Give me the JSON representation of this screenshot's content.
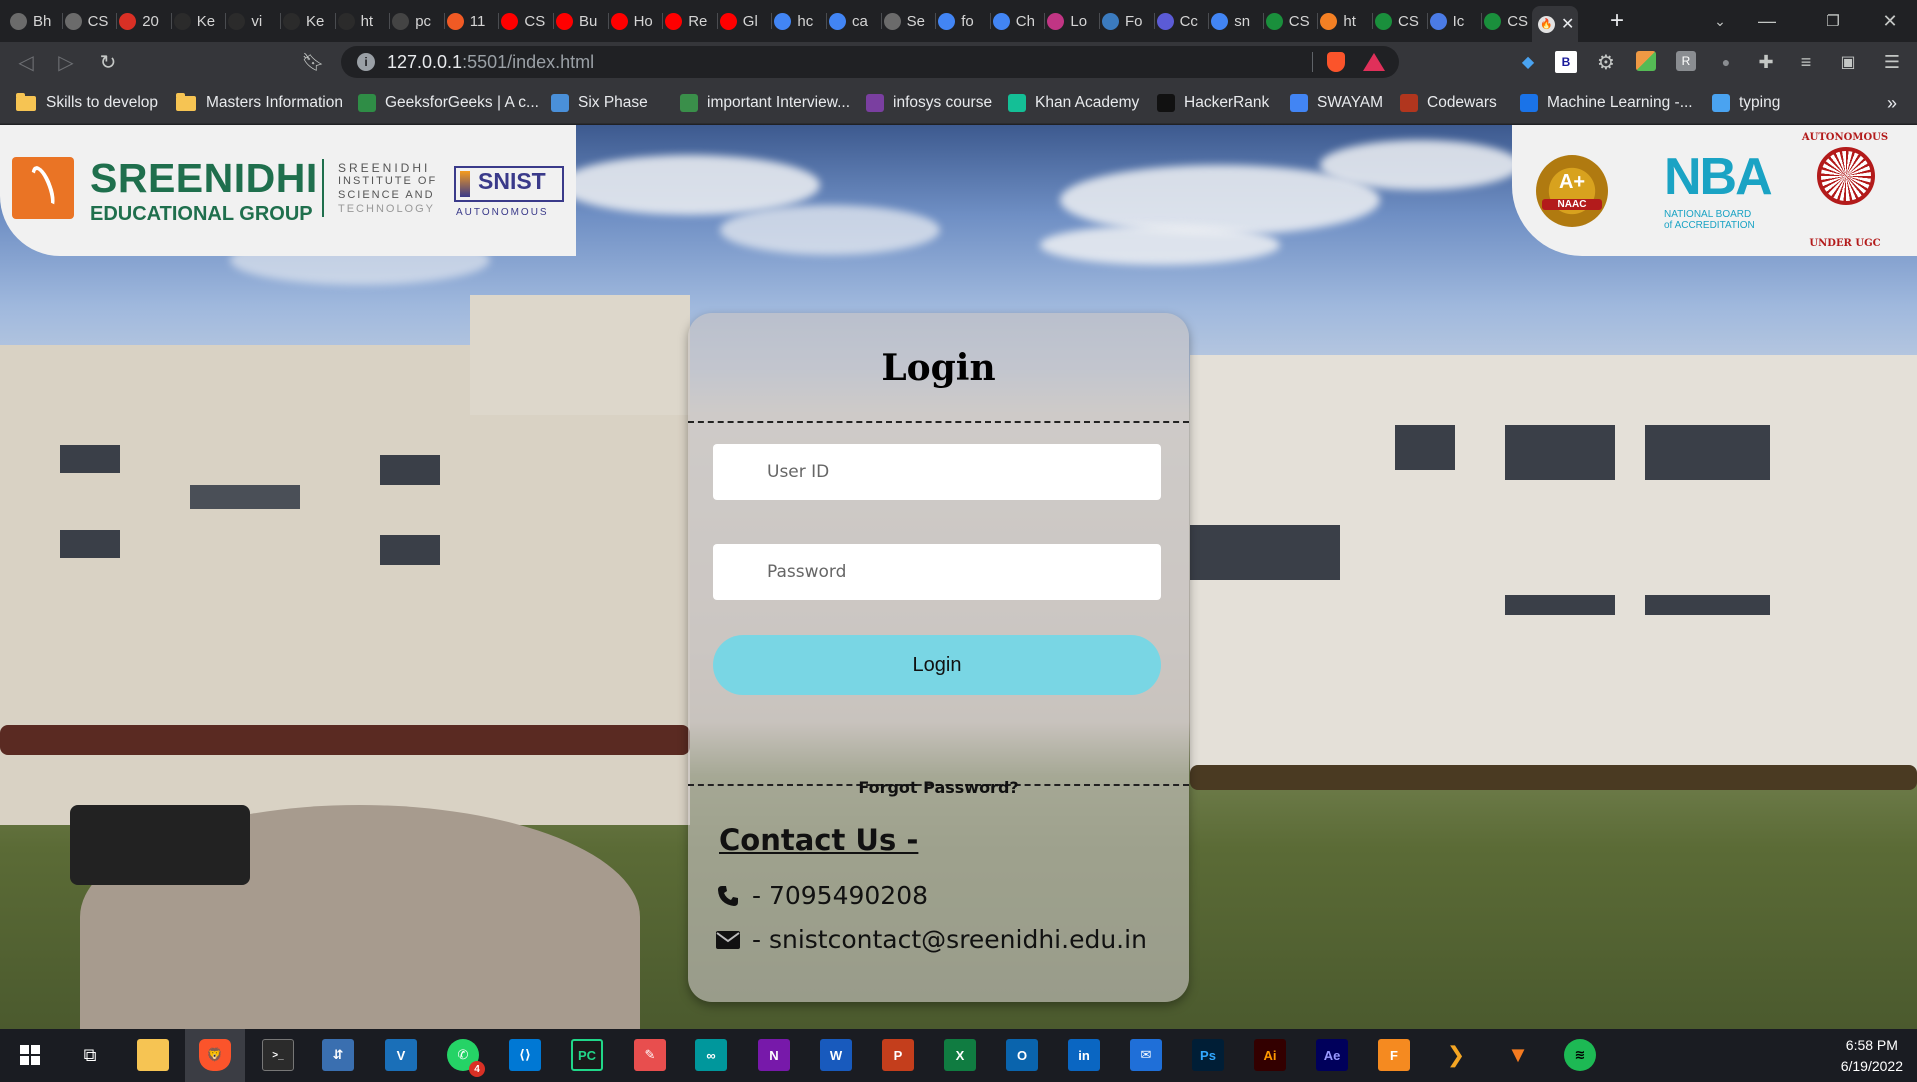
{
  "browser": {
    "tabs": [
      {
        "label": "Bh",
        "icon": "globe-icon",
        "color": "#6b6b6b"
      },
      {
        "label": "CS",
        "icon": "globe-icon",
        "color": "#6b6b6b"
      },
      {
        "label": "20",
        "icon": "gmail-icon",
        "color": "#d93025"
      },
      {
        "label": "Ke",
        "icon": "w3schools-icon",
        "color": "#2b2b2b"
      },
      {
        "label": "vi",
        "icon": "w3schools-icon",
        "color": "#2b2b2b"
      },
      {
        "label": "Ke",
        "icon": "w3schools-icon",
        "color": "#2b2b2b"
      },
      {
        "label": "ht",
        "icon": "w3schools-icon",
        "color": "#2b2b2b"
      },
      {
        "label": "pc",
        "icon": "medium-icon",
        "color": "#444444"
      },
      {
        "label": "11",
        "icon": "bookmark-orange-icon",
        "color": "#f15a24"
      },
      {
        "label": "CS",
        "icon": "youtube-icon",
        "color": "#ff0000"
      },
      {
        "label": "Bu",
        "icon": "youtube-icon",
        "color": "#ff0000"
      },
      {
        "label": "Ho",
        "icon": "youtube-icon",
        "color": "#ff0000"
      },
      {
        "label": "Re",
        "icon": "youtube-icon",
        "color": "#ff0000"
      },
      {
        "label": "Gl",
        "icon": "youtube-icon",
        "color": "#ff0000"
      },
      {
        "label": "hc",
        "icon": "google-icon",
        "color": "#4285f4"
      },
      {
        "label": "ca",
        "icon": "google-icon",
        "color": "#4285f4"
      },
      {
        "label": "Se",
        "icon": "globe-icon",
        "color": "#6b6b6b"
      },
      {
        "label": "fo",
        "icon": "google-icon",
        "color": "#4285f4"
      },
      {
        "label": "Ch",
        "icon": "google-icon",
        "color": "#4285f4"
      },
      {
        "label": "Lo",
        "icon": "instagram-icon",
        "color": "#c13584"
      },
      {
        "label": "Fo",
        "icon": "world-icon",
        "color": "#3b7bbf"
      },
      {
        "label": "Cc",
        "icon": "codepen-icon",
        "color": "#5b5bd6"
      },
      {
        "label": "sn",
        "icon": "google-icon",
        "color": "#4285f4"
      },
      {
        "label": "CS",
        "icon": "w-icon",
        "color": "#1a8f3c"
      },
      {
        "label": "ht",
        "icon": "stackoverflow-icon",
        "color": "#f48024"
      },
      {
        "label": "CS",
        "icon": "w-icon",
        "color": "#1a8f3c"
      },
      {
        "label": "Ic",
        "icon": "flag-icon",
        "color": "#4b7be5"
      },
      {
        "label": "CS",
        "icon": "w-icon",
        "color": "#1a8f3c"
      }
    ],
    "url_host": "127.0.0.1",
    "url_rest": ":5501/index.html"
  },
  "bookmarks": [
    {
      "label": "Skills to develop",
      "icon": "folder-icon",
      "color": "#f6c453"
    },
    {
      "label": "Masters Information",
      "icon": "folder-icon",
      "color": "#f6c453"
    },
    {
      "label": "GeeksforGeeks | A c...",
      "icon": "gfg-icon",
      "color": "#2f8d46"
    },
    {
      "label": "Six Phase",
      "icon": "sixphase-icon",
      "color": "#4a90d9"
    },
    {
      "label": "important Interview...",
      "icon": "runner-icon",
      "color": "#3a8f4a"
    },
    {
      "label": "infosys course",
      "icon": "infosys-icon",
      "color": "#7a3fa0"
    },
    {
      "label": "Khan Academy",
      "icon": "khan-icon",
      "color": "#14bf96"
    },
    {
      "label": "HackerRank",
      "icon": "hackerrank-icon",
      "color": "#111111"
    },
    {
      "label": "SWAYAM",
      "icon": "google-icon",
      "color": "#4285f4"
    },
    {
      "label": "Codewars",
      "icon": "codewars-icon",
      "color": "#b1361e"
    },
    {
      "label": "Machine Learning -...",
      "icon": "c-icon",
      "color": "#1a73e8"
    },
    {
      "label": "typing",
      "icon": "typing-icon",
      "color": "#4aa3f0"
    }
  ],
  "logos": {
    "left_big": "SREENIDHI",
    "left_small": "EDUCATIONAL GROUP",
    "left_inst1": "SREENIDHI",
    "left_inst2": "INSTITUTE OF",
    "left_inst3": "SCIENCE AND",
    "left_inst4": "TECHNOLOGY",
    "snist": "SNIST",
    "snist_sub": "AUTONOMOUS",
    "naac": "A+",
    "naac_sub": "NAAC",
    "nba": "NBA",
    "nba_sub1": "NATIONAL BOARD",
    "nba_sub2": "of ACCREDITATION",
    "ugc_top": "AUTONOMOUS",
    "ugc_bottom": "UNDER UGC"
  },
  "login": {
    "title": "Login",
    "userid_placeholder": "User ID",
    "password_placeholder": "Password",
    "button": "Login",
    "forgot": "Forgot Password?"
  },
  "contact": {
    "title": "Contact Us -",
    "phone": "- 7095490208",
    "email": "- snistcontact@sreenidhi.edu.in"
  },
  "taskbar": {
    "time": "6:58 PM",
    "date": "6/19/2022",
    "whatsapp_badge": "4"
  }
}
